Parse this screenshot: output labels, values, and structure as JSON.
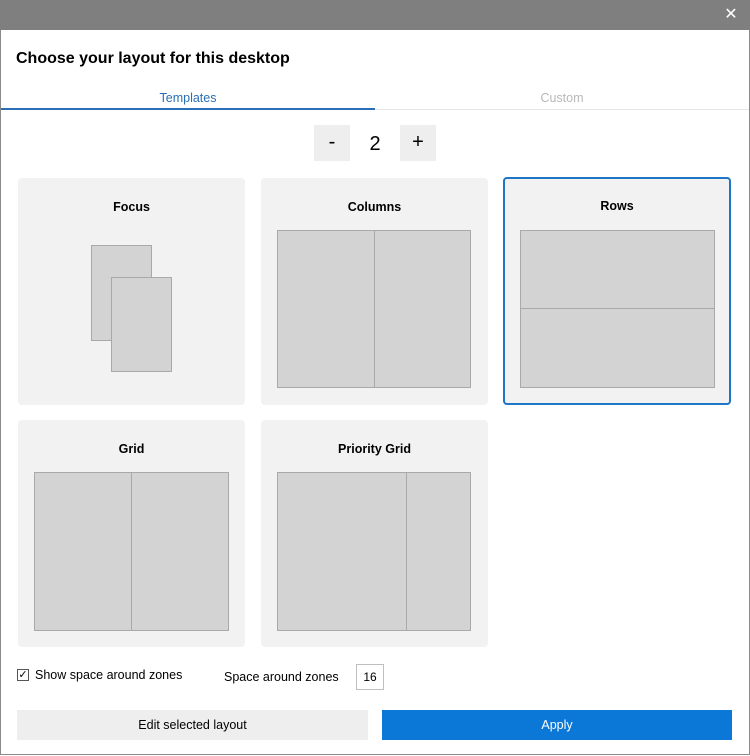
{
  "window": {
    "close_glyph": "✕"
  },
  "heading": "Choose your layout for this desktop",
  "tabs": [
    {
      "label": "Templates",
      "active": true
    },
    {
      "label": "Custom",
      "active": false
    }
  ],
  "stepper": {
    "minus": "-",
    "value": "2",
    "plus": "+"
  },
  "templates": [
    {
      "title": "Focus"
    },
    {
      "title": "Columns"
    },
    {
      "title": "Rows",
      "selected": true
    },
    {
      "title": "Grid"
    },
    {
      "title": "Priority Grid"
    }
  ],
  "options": {
    "show_space_label": "Show space around zones",
    "show_space_checked_glyph": "✓",
    "space_label": "Space around zones",
    "space_value": "16"
  },
  "actions": {
    "edit_label": "Edit selected layout",
    "apply_label": "Apply"
  },
  "colors": {
    "accent": "#1f75c6",
    "apply_bg": "#0b78d7",
    "titlebar": "#7f7f7f"
  }
}
